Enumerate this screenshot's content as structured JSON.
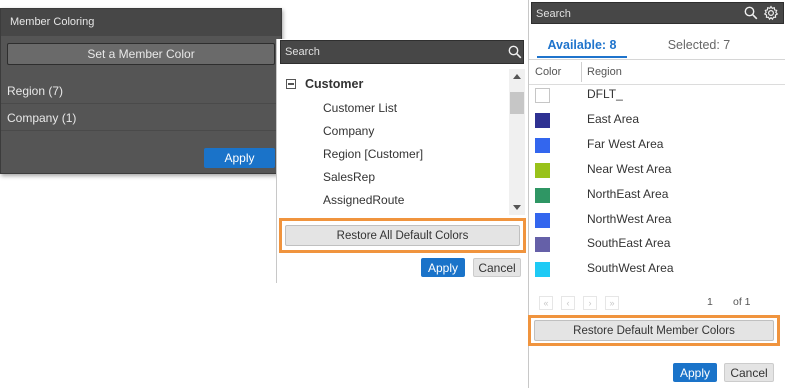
{
  "member_coloring": {
    "title": "Member Coloring",
    "set_color_label": "Set a Member Color",
    "rows": [
      {
        "label": "Region (7)"
      },
      {
        "label": "Company (1)"
      }
    ],
    "apply_label": "Apply"
  },
  "field_picker": {
    "search_placeholder": "Search",
    "group_label": "Customer",
    "items": [
      {
        "label": "Customer List"
      },
      {
        "label": "Company"
      },
      {
        "label": "Region [Customer]"
      },
      {
        "label": "SalesRep"
      },
      {
        "label": "AssignedRoute"
      }
    ],
    "restore_all_label": "Restore All Default Colors",
    "apply_label": "Apply",
    "cancel_label": "Cancel"
  },
  "member_list": {
    "search_placeholder": "Search",
    "tab_available": "Available: 8",
    "tab_selected": "Selected: 7",
    "col_color": "Color",
    "col_region": "Region",
    "regions": [
      {
        "name": "DFLT_",
        "color": ""
      },
      {
        "name": "East Area",
        "color": "#2e3192"
      },
      {
        "name": "Far West Area",
        "color": "#3366ee"
      },
      {
        "name": "Near West Area",
        "color": "#99c21a"
      },
      {
        "name": "NorthEast Area",
        "color": "#2f9664"
      },
      {
        "name": "NorthWest Area",
        "color": "#3366ee"
      },
      {
        "name": "SouthEast Area",
        "color": "#6560a8"
      },
      {
        "name": "SouthWest Area",
        "color": "#1ecaf5"
      }
    ],
    "page_number": "1",
    "page_of": "of 1",
    "restore_label": "Restore Default Member Colors",
    "apply_label": "Apply",
    "cancel_label": "Cancel"
  },
  "colors": {
    "accent_blue": "#1a73c9",
    "highlight_orange": "#f0943e",
    "dark_panel": "#555555"
  }
}
